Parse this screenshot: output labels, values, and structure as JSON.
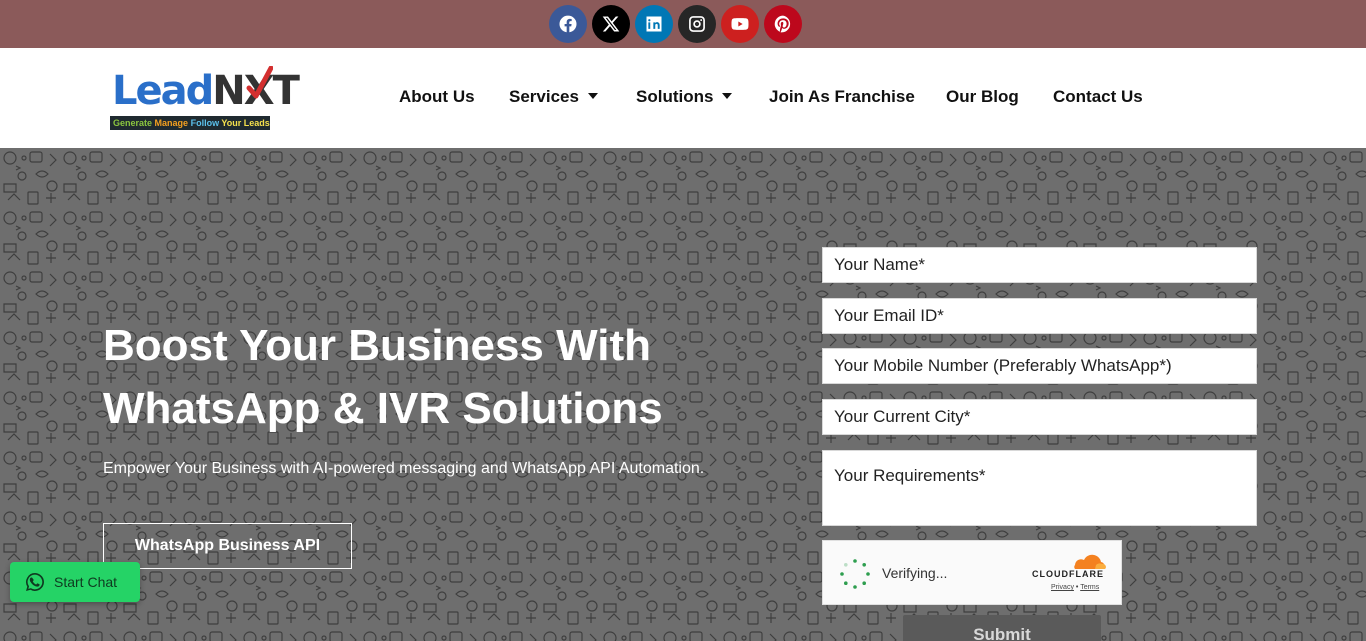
{
  "social": [
    {
      "name": "facebook",
      "color": "#3b5998"
    },
    {
      "name": "x",
      "color": "#000000"
    },
    {
      "name": "linkedin",
      "color": "#0077b5"
    },
    {
      "name": "instagram",
      "color": "#262626"
    },
    {
      "name": "youtube",
      "color": "#cd201f"
    },
    {
      "name": "pinterest",
      "color": "#bd081c"
    }
  ],
  "logo": {
    "word_lead": "Lead",
    "word_nxt": "NXT",
    "tag_1": "Generate",
    "tag_2": "Manage",
    "tag_3": "Follow",
    "tag_4": "Your Leads"
  },
  "nav": {
    "about": "About Us",
    "services": "Services",
    "solutions": "Solutions",
    "franchise": "Join As Franchise",
    "blog": "Our Blog",
    "contact": "Contact Us"
  },
  "hero": {
    "title": "Boost Your Business With WhatsApp & IVR Solutions",
    "subtitle": "Empower Your Business with AI-powered messaging and WhatsApp API Automation.",
    "cta": "WhatsApp Business API"
  },
  "form": {
    "name": "Your Name*",
    "email": "Your Email ID*",
    "mobile": "Your Mobile Number (Preferably WhatsApp*)",
    "city": "Your Current City*",
    "requirements": "Your Requirements*",
    "submit": "Submit"
  },
  "captcha": {
    "status": "Verifying...",
    "brand": "CLOUDFLARE",
    "privacy": "Privacy",
    "separator": "•",
    "terms": "Terms"
  },
  "chat": {
    "label": "Start Chat"
  },
  "colors": {
    "topbar": "#8b5a5a",
    "hero_bg": "#6e6e6e",
    "chat_green": "#25d366",
    "cloudflare_orange": "#f48120"
  }
}
